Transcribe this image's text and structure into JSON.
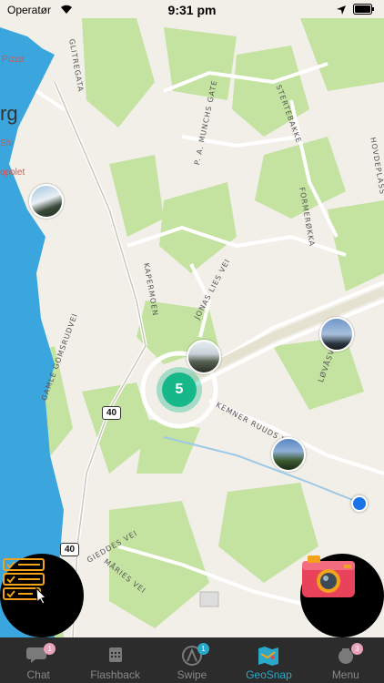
{
  "status_bar": {
    "carrier": "Operatør",
    "time": "9:31 pm"
  },
  "map": {
    "cluster_count": "5",
    "streets": [
      "GLITREGATA",
      "P. A. MUNCHS GATE",
      "STERTEBAKKE",
      "HOVDEPLASS",
      "FORMERØKKA",
      "KAPERMOEN",
      "JONAS LIES VEI",
      "LØVÅSVEIEN",
      "KEMNER RUUDS V",
      "GAMLE GOMSRUDVEI",
      "GIEDDES VEI",
      "MÅRIES VEI"
    ],
    "pois": [
      "Pizza",
      "Shi",
      "opolet"
    ],
    "city_fragment": "rg",
    "road_shields": [
      "40",
      "40"
    ]
  },
  "tabs": [
    {
      "label": "Chat",
      "badge": "1",
      "icon": "chat-icon"
    },
    {
      "label": "Flashback",
      "badge": "",
      "icon": "calendar-icon"
    },
    {
      "label": "Swipe",
      "badge": "1",
      "icon": "swipe-icon"
    },
    {
      "label": "GeoSnap",
      "badge": "",
      "icon": "map-icon",
      "active": true
    },
    {
      "label": "Menu",
      "badge": "3",
      "icon": "menu-icon"
    }
  ],
  "colors": {
    "accent": "#29a8c9",
    "cluster": "#16b88a",
    "water": "#3ba6dd",
    "park": "#b6dc8e",
    "badge_chat": "#e8a3b8",
    "badge_swipe": "#29a8c9",
    "badge_menu": "#e8a3b8"
  }
}
